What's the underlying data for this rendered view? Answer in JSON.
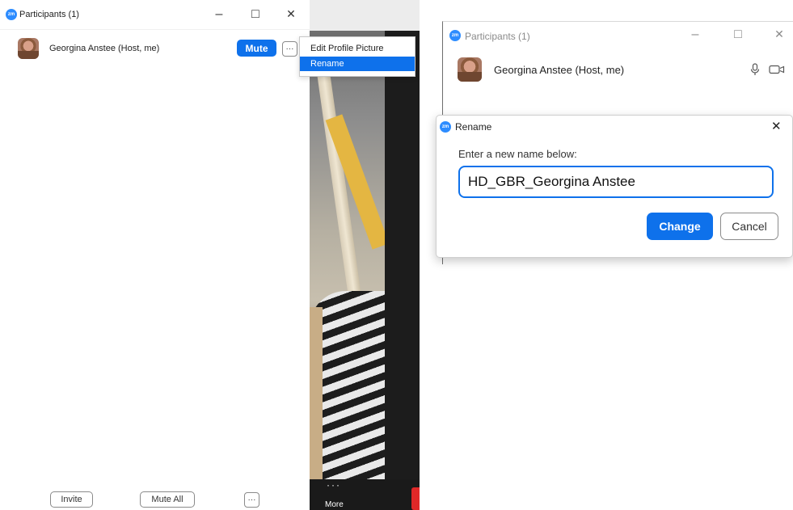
{
  "left_window": {
    "title": "Participants (1)",
    "participant_name": "Georgina Anstee (Host, me)",
    "mute_label": "Mute",
    "more_label": "···",
    "minimize_glyph": "–",
    "maximize_glyph": "□",
    "close_glyph": "✕",
    "invite_label": "Invite",
    "mute_all_label": "Mute All",
    "footer_more_label": "···"
  },
  "context_menu": {
    "items": [
      {
        "label": "Edit Profile Picture",
        "selected": false
      },
      {
        "label": "Rename",
        "selected": true
      }
    ]
  },
  "video_strip": {
    "more_dots": "···",
    "more_label": "More"
  },
  "right_window": {
    "title": "Participants (1)",
    "participant_name": "Georgina Anstee (Host, me)",
    "minimize_glyph": "–",
    "maximize_glyph": "□",
    "close_glyph": "✕"
  },
  "rename_dialog": {
    "title": "Rename",
    "close_glyph": "✕",
    "prompt": "Enter a new name below:",
    "input_value": "HD_GBR_Georgina Anstee",
    "change_label": "Change",
    "cancel_label": "Cancel"
  },
  "icons": {
    "app_logo": "zoom-logo-icon",
    "mic": "microphone-icon",
    "camera": "camera-icon"
  },
  "colors": {
    "accent_blue": "#0e71eb",
    "zoom_logo_blue": "#2d8cff"
  }
}
